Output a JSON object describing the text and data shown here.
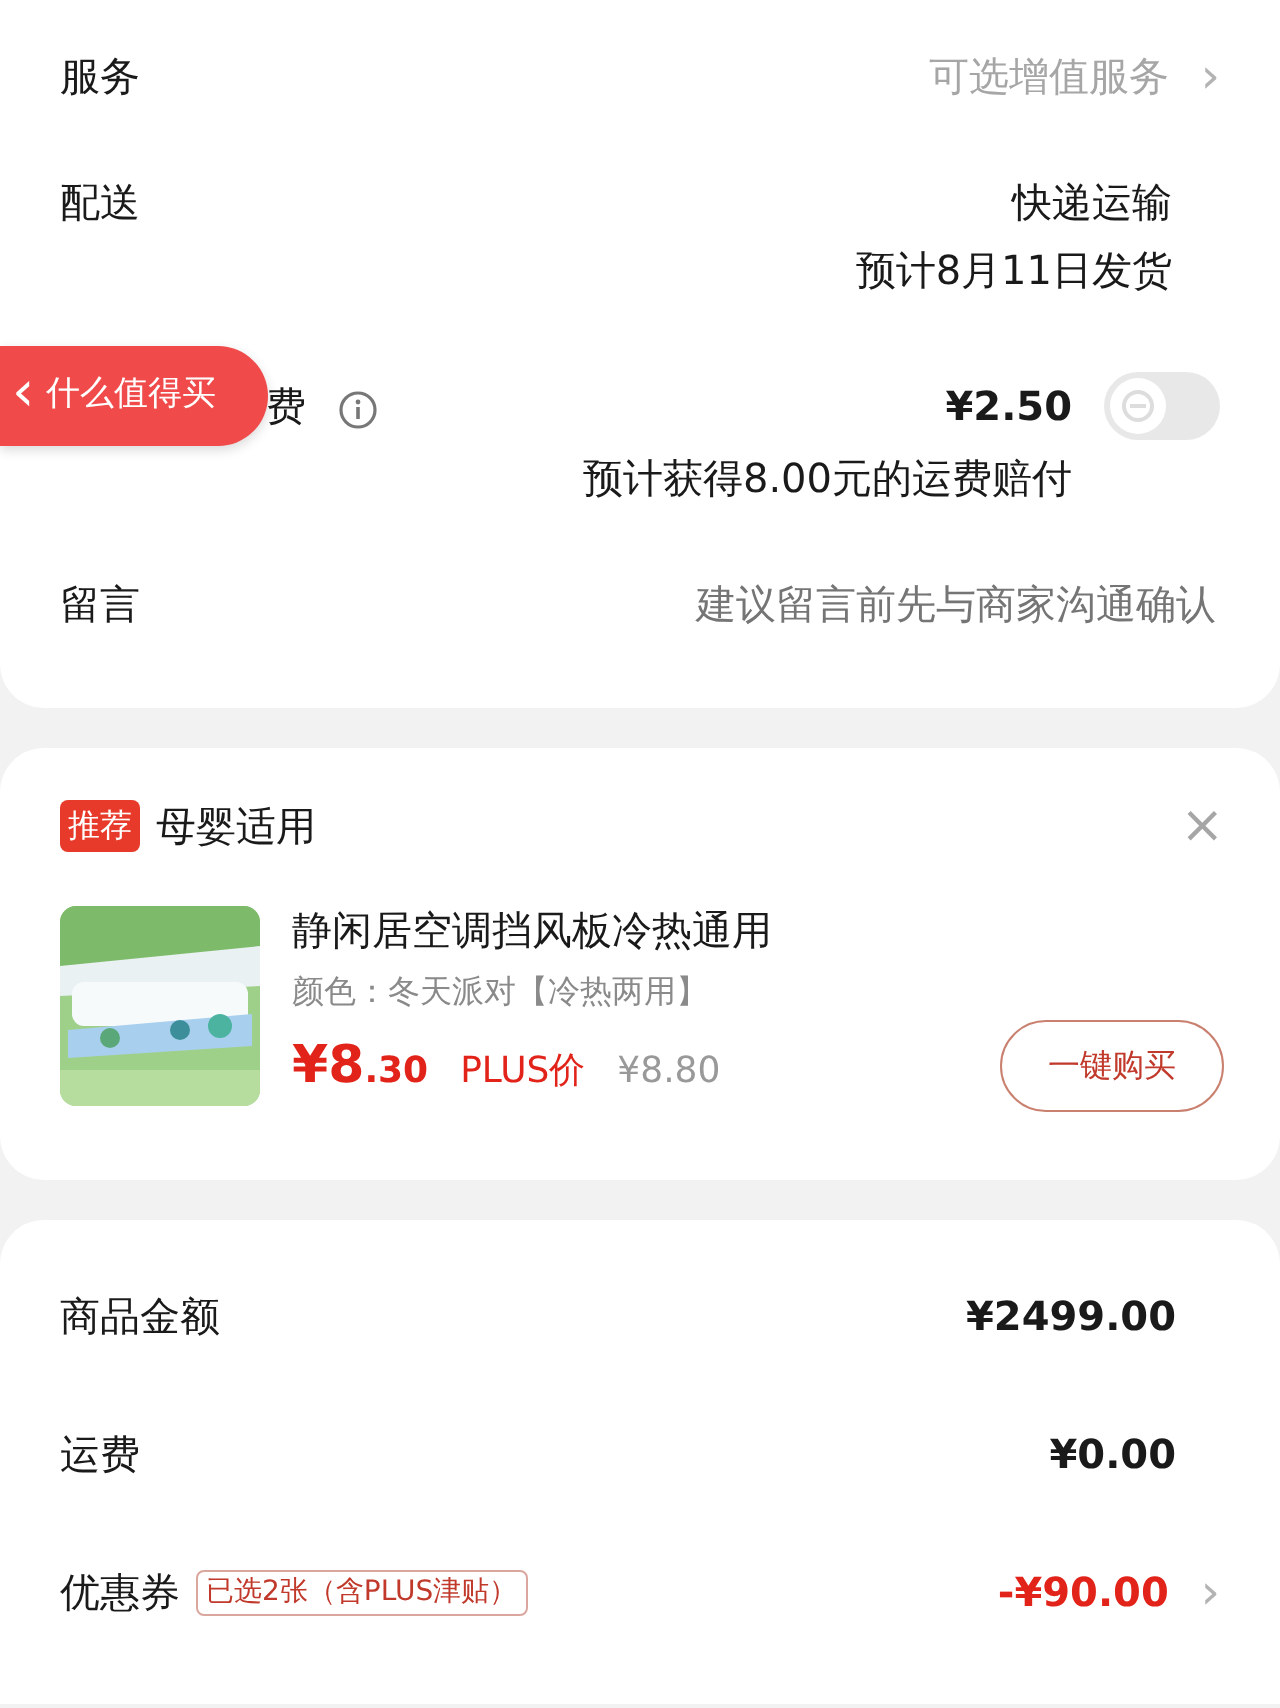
{
  "order_info": {
    "service": {
      "label": "服务",
      "value": "可选增值服务",
      "chevron": "›"
    },
    "delivery": {
      "label": "配送",
      "method": "快递运输",
      "eta": "预计8月11日发货"
    },
    "freight_insurance": {
      "label": "费",
      "price": "¥2.50",
      "note": "预计获得8.00元的运费赔付",
      "on": false
    },
    "message": {
      "label": "留言",
      "placeholder": "建议留言前先与商家沟通确认"
    }
  },
  "floating_badge": {
    "arrow": "‹",
    "label": "什么值得买"
  },
  "recommendation": {
    "tag": "推荐",
    "title": "母婴适用",
    "close": "×",
    "product": {
      "name": "静闲居空调挡风板冷热通用",
      "variant": "颜色：冬天派对【冷热两用】",
      "price_main": "¥8",
      "price_decimal": ".30",
      "price_label": "PLUS价",
      "original_price": "¥8.80",
      "buy_button": "一键购买"
    }
  },
  "summary": [
    {
      "label": "商品金额",
      "value": "¥2499.00",
      "highlight": false
    },
    {
      "label": "运费",
      "value": "¥0.00",
      "highlight": false
    },
    {
      "label": "优惠券",
      "tag": "已选2张（含PLUS津贴）",
      "value": "-¥90.00",
      "highlight": true,
      "chevron": "›"
    }
  ]
}
